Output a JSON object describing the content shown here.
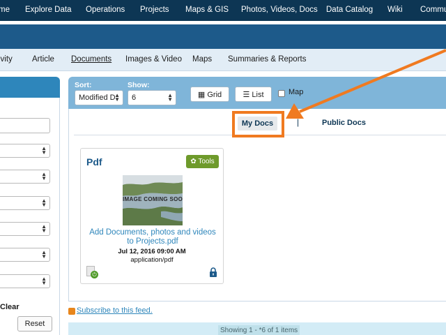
{
  "top_nav": {
    "items": [
      "me",
      "Explore Data",
      "Operations",
      "Projects",
      "Maps & GIS",
      "Photos, Videos, Docs",
      "Data Catalog",
      "Wiki",
      "Commu"
    ]
  },
  "sub_nav": {
    "items": [
      "ivity",
      "Article",
      "Documents",
      "Images & Video",
      "Maps",
      "Summaries & Reports"
    ],
    "active": "Documents"
  },
  "sidebar": {
    "clear_label": "Clear",
    "reset_label": "Reset"
  },
  "toolbar": {
    "sort_label": "Sort:",
    "sort_value": "Modified D",
    "show_label": "Show:",
    "show_value": "6",
    "grid_label": "Grid",
    "list_label": "List",
    "map_label": "Map"
  },
  "doc_tabs": {
    "my_docs": "My Docs",
    "separator": "|",
    "public_docs": "Public Docs"
  },
  "card": {
    "title": "Pdf",
    "tools_label": "Tools",
    "thumbnail_text": "IMAGE COMING SOON",
    "link_text": "Add Documents, photos and videos to Projects.pdf",
    "date": "Jul 12, 2016 09:00 AM",
    "mime_type": "application/pdf",
    "icons": [
      "file-icon",
      "download-icon",
      "lock-icon"
    ]
  },
  "footer": {
    "subscribe_text": "Subscribe to this feed.",
    "status_text": "Showing 1 - *6 of 1 items"
  },
  "colors": {
    "top_nav_bg": "#0d3654",
    "banner_bg": "#1d5a8a",
    "toolbar_bg": "#7fb5d9",
    "accent_link": "#2e86bb",
    "tools_green": "#6e9a2b",
    "annotation_orange": "#f07a20"
  }
}
